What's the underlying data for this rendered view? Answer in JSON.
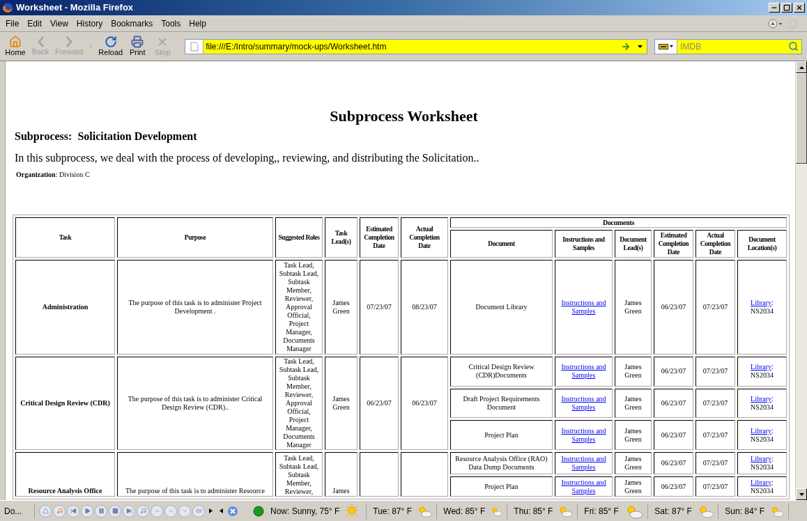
{
  "window": {
    "title": "Worksheet - Mozilla Firefox"
  },
  "menu": [
    "File",
    "Edit",
    "View",
    "History",
    "Bookmarks",
    "Tools",
    "Help"
  ],
  "toolbar": [
    {
      "label": "Home",
      "disabled": false
    },
    {
      "label": "Back",
      "disabled": true
    },
    {
      "label": "Forward",
      "disabled": true
    },
    {
      "label": "Reload",
      "disabled": false
    },
    {
      "label": "Print",
      "disabled": false
    },
    {
      "label": "Stop",
      "disabled": true
    }
  ],
  "address": {
    "value": "file:///E:/Intro/summary/mock-ups/Worksheet.htm"
  },
  "search": {
    "placeholder": "IMDB"
  },
  "page": {
    "title": "Subprocess Worksheet",
    "subprocess": "Subprocess:  Solicitation Development",
    "intro": "In this subprocess, we deal with the process of developing,, reviewing, and distributing the Solicitation..",
    "organization": "**Organization**: Division C"
  },
  "table": {
    "columns": [
      "Task",
      "Purpose",
      "Suggested Roles",
      "Task Lead(s)",
      "Estimated Completion Date",
      "Actual Completion Date"
    ],
    "group": "Documents",
    "doc_columns": [
      "Document",
      "Instructions and Samples",
      "Document Lead(s)",
      "Estimated Completion Date",
      "Actual Completion Date",
      "Document Location(s)"
    ],
    "tasks": [
      {
        "name": "Administration",
        "purpose": "The purpose of this task is to administer Project Development .",
        "roles": "Task Lead, Subtask Lead, Subtask Member, Reviewer, Approval Official, Project Manager, Documents Manager",
        "lead": "James Green",
        "estimated": "07/23/07",
        "actual": "08/23/07",
        "documents": [
          {
            "name": "Document Library",
            "instructions": "Instructions and Samples",
            "lead": "James Green",
            "estimated": "06/23/07",
            "actual": "07/23/07",
            "location": {
              "link": "Library",
              "sep": ":",
              "code": "NS2034"
            }
          }
        ]
      },
      {
        "name": "Critical Design Review (CDR)",
        "purpose": "The purpose of this task is to administer Critical Design Review (CDR)..",
        "roles": "Task Lead, Subtask Lead, Subtask Member, Reviewer, Approval Official, Project Manager, Documents Manager",
        "lead": "James Green",
        "estimated": "06/23/07",
        "actual": "06/23/07",
        "documents": [
          {
            "name": "Critical Design Review (CDR)Documents",
            "instructions": "Instructions and Samples",
            "lead": "James Green",
            "estimated": "06/23/07",
            "actual": "07/23/07",
            "location": {
              "link": "Library",
              "sep": ":",
              "code": "NS2034"
            }
          },
          {
            "name": "Draft Project Requirements Document",
            "instructions": "Instructions and Samples",
            "lead": "James Green",
            "estimated": "06/23/07",
            "actual": "07/23/07",
            "location": {
              "link": "Library",
              "sep": ":",
              "code": "NS2034"
            }
          },
          {
            "name": "Project Plan",
            "instructions": "Instructions and Samples",
            "lead": "James Green",
            "estimated": "06/23/07",
            "actual": "07/23/07",
            "location": {
              "link": "Library",
              "sep": ":",
              "code": "NS2034"
            }
          }
        ]
      },
      {
        "name": "Resource Analysis Office",
        "purpose": "The purpose of this task is to administer Resource",
        "roles": "Task Lead, Subtask Lead, Subtask Member, Reviewer,",
        "lead": "James",
        "documents": [
          {
            "name": "Resource Analysis Office (RAO) Data Dump Documents",
            "instructions": "Instructions and Samples",
            "lead": "James Green",
            "estimated": "06/23/07",
            "actual": "07/23/07",
            "location": {
              "link": "Library",
              "sep": ":",
              "code": "NS2034"
            }
          },
          {
            "name": "Project Plan",
            "instructions": "Instructions and Samples",
            "lead": "James Green",
            "estimated": "06/23/07",
            "actual": "07/23/07",
            "location": {
              "link": "Library",
              "sep": ":",
              "code": "NS2034"
            }
          }
        ]
      }
    ]
  },
  "status": {
    "text": "Do..."
  },
  "weather": [
    {
      "kind": "current",
      "label": "Now: Sunny, 75° F"
    },
    {
      "kind": "forecast",
      "label": "Tue: 87° F"
    },
    {
      "kind": "forecast",
      "label": "Wed: 85° F"
    },
    {
      "kind": "forecast",
      "label": "Thu: 85° F"
    },
    {
      "kind": "forecast",
      "label": "Fri: 85° F"
    },
    {
      "kind": "forecast",
      "label": "Sat: 87° F"
    },
    {
      "kind": "forecast",
      "label": "Sun: 84° F"
    }
  ]
}
